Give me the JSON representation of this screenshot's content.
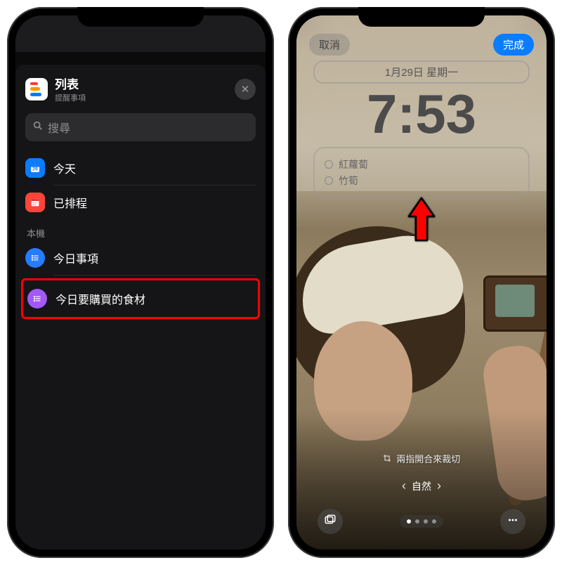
{
  "left": {
    "sheet": {
      "title": "列表",
      "subtitle": "提醒事項",
      "search_placeholder": "搜尋",
      "smart_lists": [
        {
          "label": "今天",
          "icon": "today",
          "color": "#0a7cff"
        },
        {
          "label": "已排程",
          "icon": "scheduled",
          "color": "#ff4539"
        }
      ],
      "section_label": "本機",
      "custom_lists": [
        {
          "label": "今日事項",
          "icon": "list",
          "color": "#257cff",
          "highlighted": false
        },
        {
          "label": "今日要購買的食材",
          "icon": "list",
          "color": "#a357ff",
          "highlighted": true
        }
      ]
    }
  },
  "right": {
    "cancel": "取消",
    "done": "完成",
    "date": "1月29日 星期一",
    "time": "7:53",
    "widget_items": [
      "紅蘿蔔",
      "竹筍"
    ],
    "crop_hint": "兩指開合來裁切",
    "filter_label": "自然",
    "page_dots": {
      "count": 4,
      "active": 0
    }
  }
}
